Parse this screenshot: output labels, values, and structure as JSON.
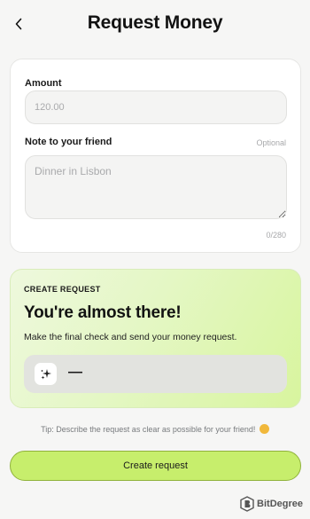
{
  "header": {
    "title": "Request Money",
    "back_icon": "chevron-left-icon"
  },
  "form": {
    "amount_label": "Amount",
    "amount_placeholder": "120.00",
    "note_label": "Note to your friend",
    "note_optional": "Optional",
    "note_placeholder": "Dinner in Lisbon",
    "char_count": "0/280"
  },
  "summary": {
    "caption": "CREATE REQUEST",
    "title": "You're almost there!",
    "subtitle": "Make the final check and send your money request.",
    "preview_value": "—",
    "sparkle_icon": "sparkle-icon"
  },
  "tip": "Tip: Describe the request as clear as possible for your friend!",
  "button": {
    "label": "Create request"
  },
  "watermark": {
    "text": "BitDegree"
  },
  "colors": {
    "background": "#f6f6f5",
    "accent": "#c7ee6c",
    "accent_border": "#8fb23a",
    "card_gradient_start": "#eef8dd",
    "card_gradient_end": "#d8f59e"
  }
}
